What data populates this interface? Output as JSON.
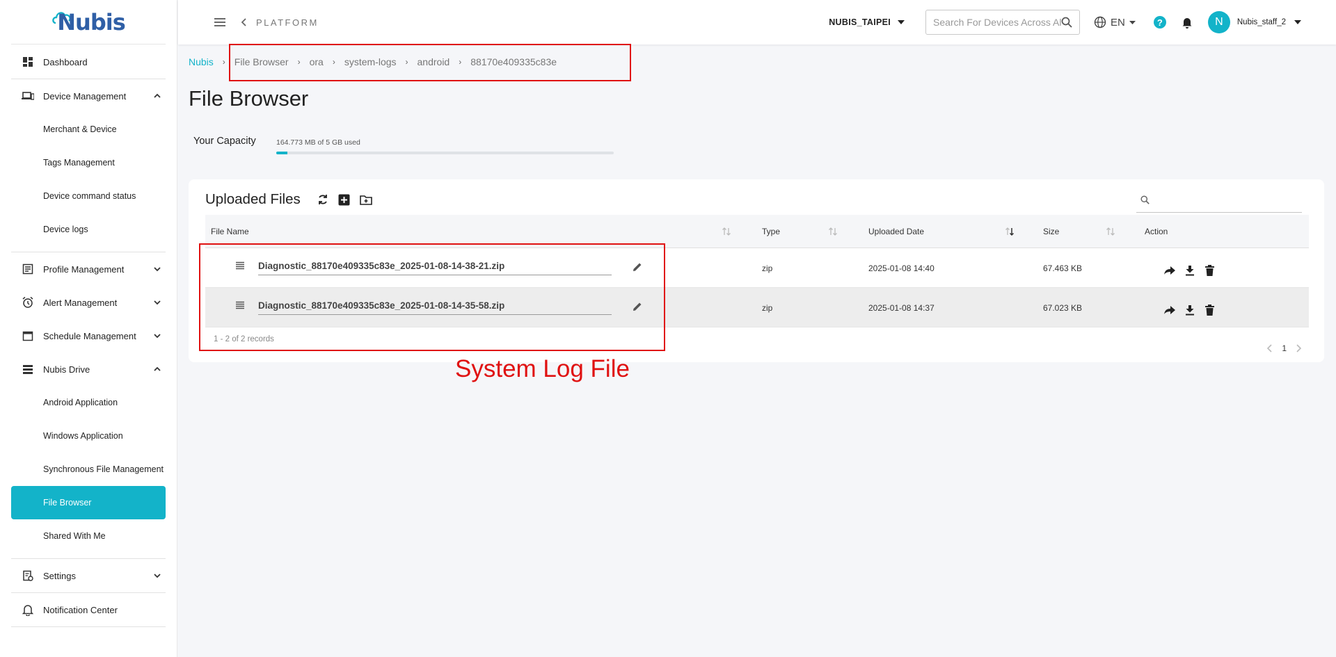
{
  "brand": {
    "logo_text": "Nubis",
    "accent": "#13b3c9",
    "annotation_color": "#e01111"
  },
  "sidebar": {
    "items": [
      {
        "label": "Dashboard",
        "icon": "dashboard-icon"
      },
      {
        "label": "Device Management",
        "icon": "devices-icon",
        "expanded": true,
        "children": [
          "Merchant & Device",
          "Tags Management",
          "Device command status",
          "Device logs"
        ]
      },
      {
        "label": "Profile Management",
        "icon": "profile-icon",
        "expanded": false
      },
      {
        "label": "Alert Management",
        "icon": "alarm-icon",
        "expanded": false
      },
      {
        "label": "Schedule Management",
        "icon": "calendar-icon",
        "expanded": false
      },
      {
        "label": "Nubis Drive",
        "icon": "storage-icon",
        "expanded": true,
        "children": [
          "Android Application",
          "Windows Application",
          "Synchronous File Management",
          "File Browser",
          "Shared With Me"
        ]
      },
      {
        "label": "Settings",
        "icon": "settings-icon",
        "expanded": false
      },
      {
        "label": "Notification Center",
        "icon": "notification-icon"
      }
    ],
    "active": "File Browser"
  },
  "topbar": {
    "section": "PLATFORM",
    "org": "NUBIS_TAIPEI",
    "search_placeholder": "Search For Devices Across All Organizations",
    "lang": "EN",
    "help": "?",
    "avatar_initial": "N",
    "username": "Nubis_staff_2"
  },
  "breadcrumb": [
    "Nubis",
    "File Browser",
    "ora",
    "system-logs",
    "android",
    "88170e409335c83e"
  ],
  "page": {
    "title": "File Browser"
  },
  "capacity": {
    "label": "Your Capacity",
    "text": "164.773 MB of 5 GB used",
    "fraction": 0.032
  },
  "files": {
    "title": "Uploaded Files",
    "columns": [
      "File Name",
      "Type",
      "Uploaded Date",
      "Size",
      "Action"
    ],
    "rows": [
      {
        "name": "Diagnostic_88170e409335c83e_2025-01-08-14-38-21.zip",
        "type": "zip",
        "date": "2025-01-08 14:40",
        "size": "67.463 KB"
      },
      {
        "name": "Diagnostic_88170e409335c83e_2025-01-08-14-35-58.zip",
        "type": "zip",
        "date": "2025-01-08 14:37",
        "size": "67.023 KB"
      }
    ],
    "records": "1 - 2 of 2 records",
    "page": "1"
  },
  "annotation": "System Log File"
}
